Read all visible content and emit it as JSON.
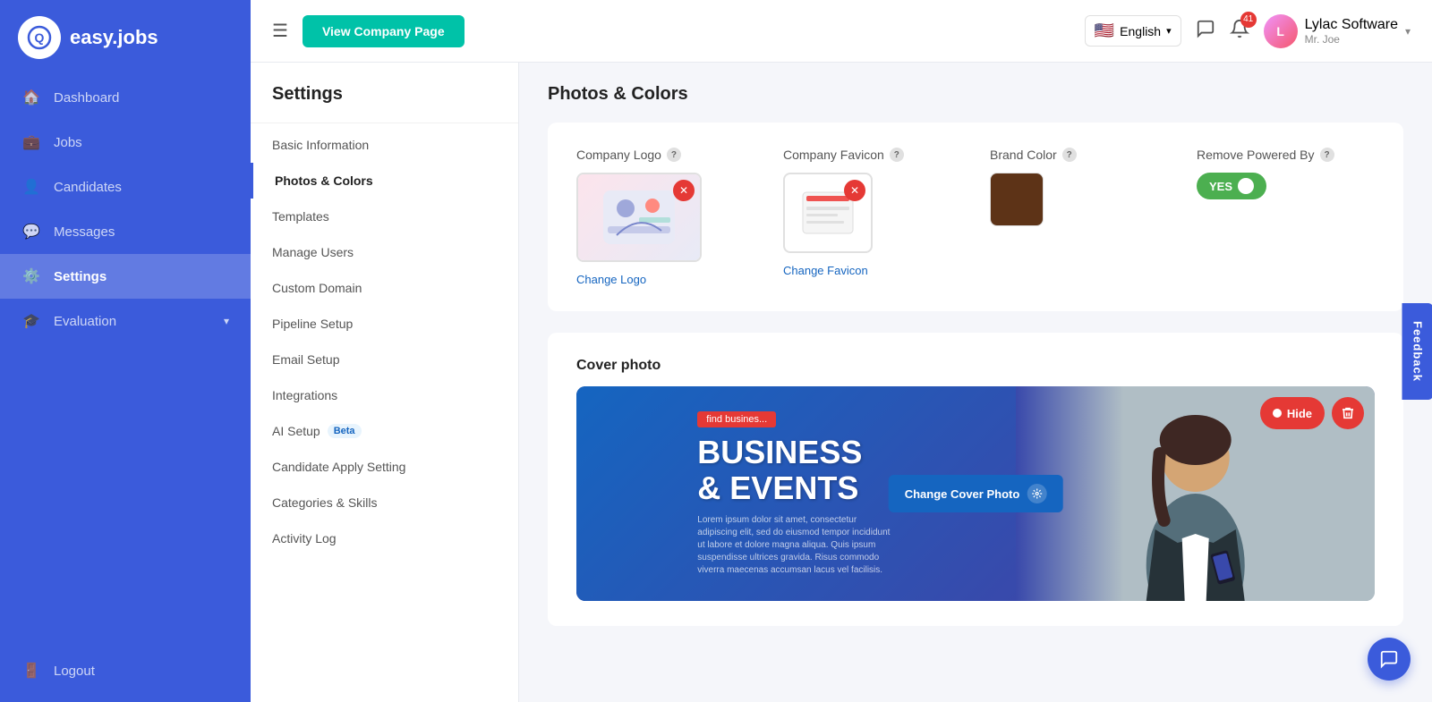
{
  "app": {
    "logo_letter": "Q",
    "logo_name": "easy.jobs"
  },
  "sidebar": {
    "nav_items": [
      {
        "id": "dashboard",
        "label": "Dashboard",
        "icon": "🏠",
        "active": false
      },
      {
        "id": "jobs",
        "label": "Jobs",
        "icon": "💼",
        "active": false
      },
      {
        "id": "candidates",
        "label": "Candidates",
        "icon": "👤",
        "active": false
      },
      {
        "id": "messages",
        "label": "Messages",
        "icon": "💬",
        "active": false
      },
      {
        "id": "settings",
        "label": "Settings",
        "icon": "⚙️",
        "active": true
      },
      {
        "id": "evaluation",
        "label": "Evaluation",
        "icon": "🎓",
        "active": false
      }
    ],
    "logout_label": "Logout"
  },
  "topbar": {
    "hamburger_icon": "☰",
    "view_company_btn": "View Company Page",
    "language": "English",
    "notification_count": "41",
    "user_company": "Lylac Software",
    "user_name": "Mr. Joe"
  },
  "settings": {
    "title": "Settings",
    "menu_items": [
      {
        "id": "basic-info",
        "label": "Basic Information",
        "active": false
      },
      {
        "id": "photos-colors",
        "label": "Photos & Colors",
        "active": true
      },
      {
        "id": "templates",
        "label": "Templates",
        "active": false
      },
      {
        "id": "manage-users",
        "label": "Manage Users",
        "active": false
      },
      {
        "id": "custom-domain",
        "label": "Custom Domain",
        "active": false
      },
      {
        "id": "pipeline-setup",
        "label": "Pipeline Setup",
        "active": false
      },
      {
        "id": "email-setup",
        "label": "Email Setup",
        "active": false
      },
      {
        "id": "integrations",
        "label": "Integrations",
        "active": false
      },
      {
        "id": "ai-setup",
        "label": "AI Setup",
        "active": false,
        "badge": "Beta"
      },
      {
        "id": "candidate-apply",
        "label": "Candidate Apply Setting",
        "active": false
      },
      {
        "id": "categories-skills",
        "label": "Categories & Skills",
        "active": false
      },
      {
        "id": "activity-log",
        "label": "Activity Log",
        "active": false
      }
    ]
  },
  "photos_colors": {
    "section_title": "Photos & Colors",
    "company_logo": {
      "label": "Company Logo",
      "change_link": "Change Logo"
    },
    "company_favicon": {
      "label": "Company Favicon",
      "change_link": "Change Favicon"
    },
    "brand_color": {
      "label": "Brand Color",
      "color": "#5d3317"
    },
    "remove_powered_by": {
      "label": "Remove Powered By",
      "toggle_yes": "YES",
      "enabled": true
    },
    "cover_photo": {
      "section_title": "Cover photo",
      "change_btn": "Change Cover Photo",
      "hide_btn": "Hide",
      "business_tag": "find busines...",
      "business_title": "BUSINESS\n& EVENTS",
      "lorem_text": "Lorem ipsum dolor sit amet, consectetur adipiscing elit, sed do eiusmod tempor incididunt ut labore et dolore magna aliqua. Quis ipsum suspendisse ultrices gravida. Risus commodo viverra maecenas accumsan lacus vel facilisis."
    }
  },
  "feedback_tab": "Feedback",
  "chat_icon": "💬"
}
